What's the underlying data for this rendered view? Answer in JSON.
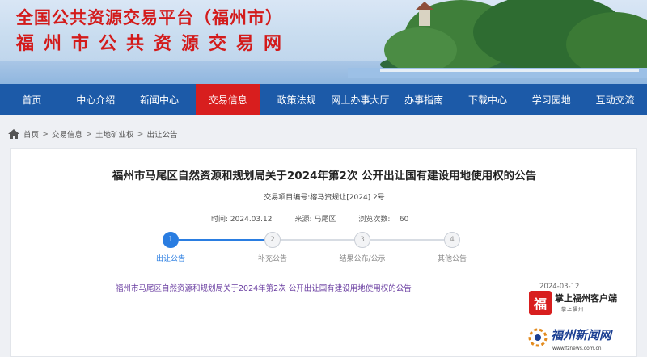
{
  "header": {
    "title": "全国公共资源交易平台（福州市）",
    "subtitle": "福州市公共资源交易网"
  },
  "nav": {
    "items": [
      {
        "label": "首页"
      },
      {
        "label": "中心介绍"
      },
      {
        "label": "新闻中心"
      },
      {
        "label": "交易信息",
        "active": true
      },
      {
        "label": "政策法规"
      },
      {
        "label": "网上办事大厅"
      },
      {
        "label": "办事指南"
      },
      {
        "label": "下载中心"
      },
      {
        "label": "学习园地"
      },
      {
        "label": "互动交流"
      }
    ]
  },
  "breadcrumb": {
    "icon": "home-icon",
    "items": [
      "首页",
      "交易信息",
      "土地矿业权",
      "出让公告"
    ],
    "separator": ">"
  },
  "notice": {
    "title": "福州市马尾区自然资源和规划局关于2024年第2次 公开出让国有建设用地使用权的公告",
    "project_no": "交易项目编号:榕马资规让[2024] 2号",
    "meta": {
      "time_label": "时间:",
      "time": "2024.03.12",
      "source_label": "来源:",
      "source": "马尾区",
      "views_label": "浏览次数:",
      "views": "60"
    },
    "steps": [
      {
        "number": "1",
        "label": "出让公告",
        "active": true
      },
      {
        "number": "2",
        "label": "补充公告"
      },
      {
        "number": "3",
        "label": "结果公布/公示"
      },
      {
        "number": "4",
        "label": "其他公告"
      }
    ],
    "link_text": "福州市马尾区自然资源和规划局关于2024年第2次 公开出让国有建设用地使用权的公告",
    "link_date": "2024-03-12"
  },
  "watermarks": {
    "app": {
      "logo": "福",
      "text": "掌上福州客户端",
      "sub": "掌上福州"
    },
    "news": {
      "text": "福州新闻网",
      "url": "www.fznews.com.cn"
    }
  },
  "colors": {
    "primary_nav": "#1c5aa8",
    "active_nav": "#d81e1e",
    "step_active": "#2a7de1",
    "title_red": "#d31b1b"
  }
}
